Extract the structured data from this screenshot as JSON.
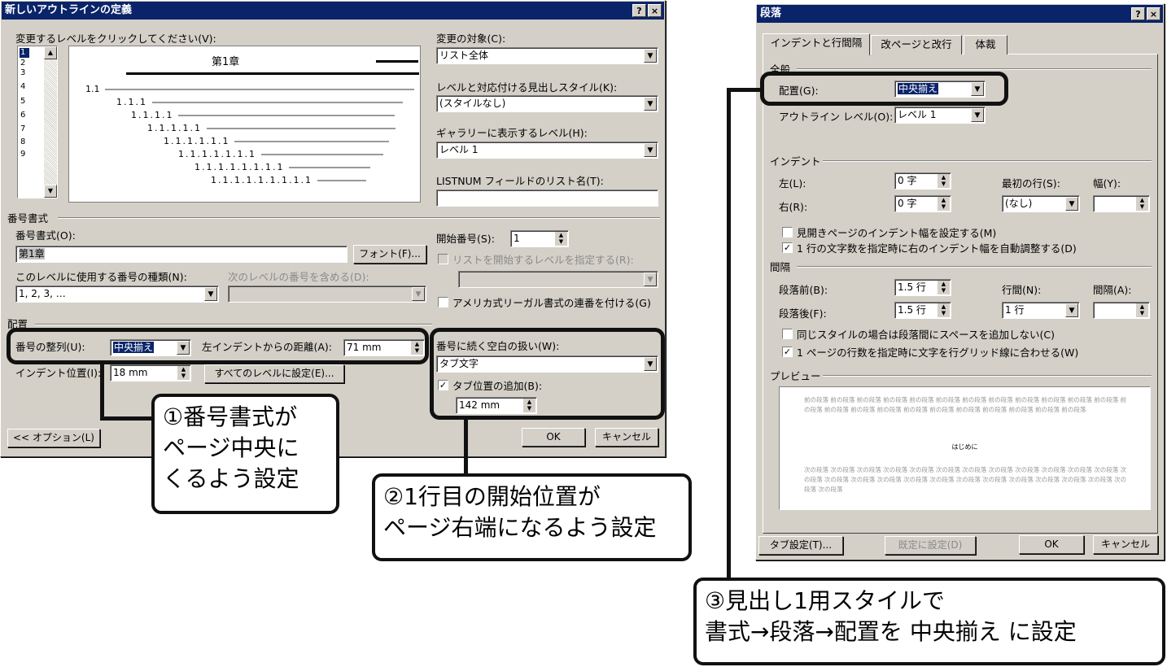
{
  "outline_dialog": {
    "title": "新しいアウトラインの定義",
    "help_button": "?",
    "close_button": "×",
    "level_label": "変更するレベルをクリックしてください(V):",
    "levels": [
      "1",
      "2",
      "3",
      "4",
      "5",
      "6",
      "7",
      "8",
      "9"
    ],
    "preview_heading": "第1章",
    "preview_lines": [
      "1.1",
      "1.1.1",
      "1.1.1.1",
      "1.1.1.1.1",
      "1.1.1.1.1.1",
      "1.1.1.1.1.1.1",
      "1.1.1.1.1.1.1.1",
      "1.1.1.1.1.1.1.1.1"
    ],
    "apply_to_label": "変更の対象(C):",
    "apply_to_value": "リスト全体",
    "link_style_label": "レベルと対応付ける見出しスタイル(K):",
    "link_style_value": "(スタイルなし)",
    "gallery_level_label": "ギャラリーに表示するレベル(H):",
    "gallery_level_value": "レベル 1",
    "listnum_label": "LISTNUM フィールドのリスト名(T):",
    "listnum_value": "",
    "number_format_group": "番号書式",
    "number_format_label": "番号書式(O):",
    "number_format_value": "第1章",
    "font_button": "フォント(F)...",
    "start_at_label": "開始番号(S):",
    "start_at_value": "1",
    "restart_label": "リストを開始するレベルを指定する(R):",
    "number_style_label": "このレベルに使用する番号の種類(N):",
    "number_style_value": "1, 2, 3, …",
    "include_level_label": "次のレベルの番号を含める(D):",
    "legal_label": "アメリカ式リーガル書式の連番を付ける(G)",
    "position_group": "配置",
    "alignment_label": "番号の整列(U):",
    "alignment_value": "中央揃え",
    "aligned_at_label": "左インデントからの距離(A):",
    "aligned_at_value": "71 mm",
    "indent_label": "インデント位置(I):",
    "indent_value": "18 mm",
    "set_all_button": "すべてのレベルに設定(E)...",
    "follow_label": "番号に続く空白の扱い(W):",
    "follow_value": "タブ文字",
    "tab_add_label": "タブ位置の追加(B):",
    "tab_add_value": "142 mm",
    "options_button": "<< オプション(L)",
    "ok_button": "OK",
    "cancel_button": "キャンセル"
  },
  "para_dialog": {
    "title": "段落",
    "help_button": "?",
    "close_button": "×",
    "tabs": [
      "インデントと行間隔",
      "改ページと改行",
      "体裁"
    ],
    "general_group": "全般",
    "alignment_label": "配置(G):",
    "alignment_value": "中央揃え",
    "outline_label": "アウトライン レベル(O):",
    "outline_value": "レベル 1",
    "indent_group": "インデント",
    "left_label": "左(L):",
    "left_value": "0 字",
    "right_label": "右(R):",
    "right_value": "0 字",
    "special_label": "最初の行(S):",
    "special_value": "(なし)",
    "by_label": "幅(Y):",
    "by_value": "",
    "mirror_label": "見開きページのインデント幅を設定する(M)",
    "auto_adjust_label": "1 行の文字数を指定時に右のインデント幅を自動調整する(D)",
    "spacing_group": "間隔",
    "before_label": "段落前(B):",
    "before_value": "1.5 行",
    "after_label": "段落後(F):",
    "after_value": "1.5 行",
    "line_spacing_label": "行間(N):",
    "line_spacing_value": "1 行",
    "at_label": "間隔(A):",
    "at_value": "",
    "no_space_label": "同じスタイルの場合は段落間にスペースを追加しない(C)",
    "snap_grid_label": "1 ページの行数を指定時に文字を行グリッド線に合わせる(W)",
    "preview_group": "プレビュー",
    "preview_prev_text": "前の段落 前の段落 前の段落 前の段落 前の段落 前の段落 前の段落 前の段落 前の段落 前の段落 前の段落 前の段落 前の段落 前の段落 前の段落 前の段落 前の段落 前の段落 前の段落 前の段落 前の段落 前の段落 前の段落",
    "preview_main_text": "はじめに",
    "preview_next_text": "次の段落 次の段落 次の段落 次の段落 次の段落 次の段落 次の段落 次の段落 次の段落 次の段落 次の段落 次の段落 次の段落 次の段落 次の段落 次の段落 次の段落 次の段落 次の段落 次の段落 次の段落 次の段落 次の段落 次の段落 次の段落 次の段落",
    "tabs_button": "タブ設定(T)...",
    "default_button": "既定に設定(D)",
    "ok_button": "OK",
    "cancel_button": "キャンセル"
  },
  "callouts": {
    "c1_line1": "①番号書式が",
    "c1_line2": "ページ中央に",
    "c1_line3": "くるよう設定",
    "c2_line1": "②1行目の開始位置が",
    "c2_line2": "ページ右端になるよう設定",
    "c3_line1": "③見出し1用スタイルで",
    "c3_line2": "書式→段落→配置を 中央揃え に設定"
  }
}
